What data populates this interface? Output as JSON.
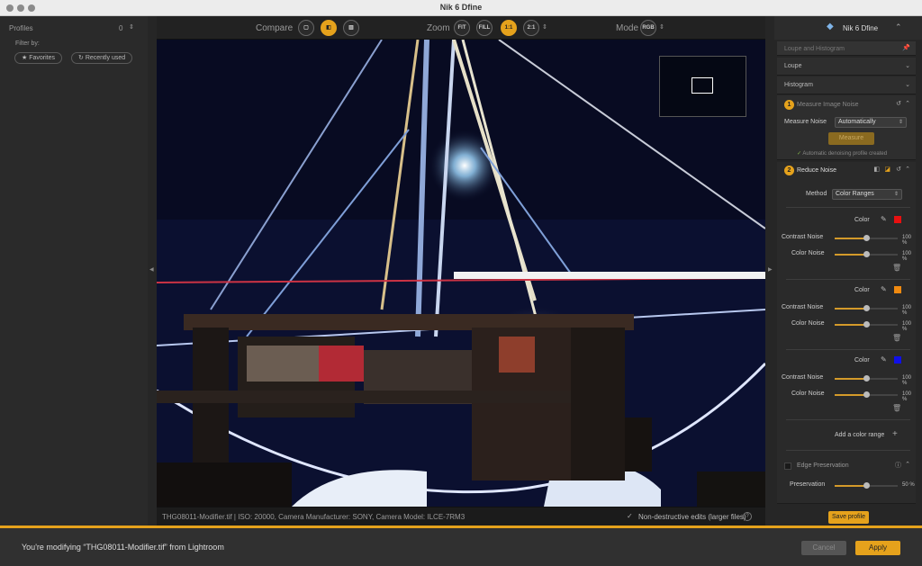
{
  "window": {
    "title": "Nik 6 Dfine"
  },
  "left_panel": {
    "header": "Profiles",
    "count": "0",
    "filter_label": "Filter by:",
    "filters": [
      {
        "label": "Favorites",
        "icon": "star-icon"
      },
      {
        "label": "Recently used",
        "icon": "history-icon"
      }
    ]
  },
  "toolbar": {
    "compare_label": "Compare",
    "zoom_label": "Zoom",
    "zoom_options": [
      "FIT",
      "FILL",
      "1:1",
      "2:1"
    ],
    "zoom_selected": "1:1",
    "mode_label": "Mode",
    "mode_value": "RGB"
  },
  "status": {
    "filename": "THG08011-Modifier.tif",
    "meta": "ISO: 20000, Camera Manufacturer: SONY, Camera Model: ILCE-7RM3",
    "nondestructive": "Non-destructive edits (larger files)"
  },
  "right_panel": {
    "brand": "Nik 6 Dfine",
    "loupe_hist": "Loupe and Histogram",
    "loupe": "Loupe",
    "histogram": "Histogram",
    "step1": {
      "num": "1",
      "title": "Measure Image Noise",
      "measure_label": "Measure Noise",
      "measure_value": "Automatically",
      "measure_button": "Measure",
      "note": "Automatic denoising profile created"
    },
    "step2": {
      "num": "2",
      "title": "Reduce Noise",
      "method_label": "Method",
      "method_value": "Color Ranges",
      "color_label": "Color",
      "contrast_label": "Contrast Noise",
      "colornoise_label": "Color Noise",
      "ranges": [
        {
          "color": "#e81010",
          "contrast": "100 %",
          "colornoise": "100 %",
          "contrast_level": 0.5,
          "colornoise_level": 0.5
        },
        {
          "color": "#f08a10",
          "contrast": "100 %",
          "colornoise": "100 %",
          "contrast_level": 0.5,
          "colornoise_level": 0.5
        },
        {
          "color": "#1010e8",
          "contrast": "100 %",
          "colornoise": "100 %",
          "contrast_level": 0.5,
          "colornoise_level": 0.5
        }
      ],
      "add_range": "Add a color range"
    },
    "edge": {
      "title": "Edge Preservation",
      "preservation_label": "Preservation",
      "preservation_value": "50 %",
      "preservation_level": 0.5
    },
    "save_profile": "Save profile"
  },
  "bottom": {
    "message": "You're modifying “THG08011-Modifier.tif” from Lightroom",
    "cancel": "Cancel",
    "apply": "Apply"
  },
  "colors": {
    "accent": "#e5a21c"
  }
}
